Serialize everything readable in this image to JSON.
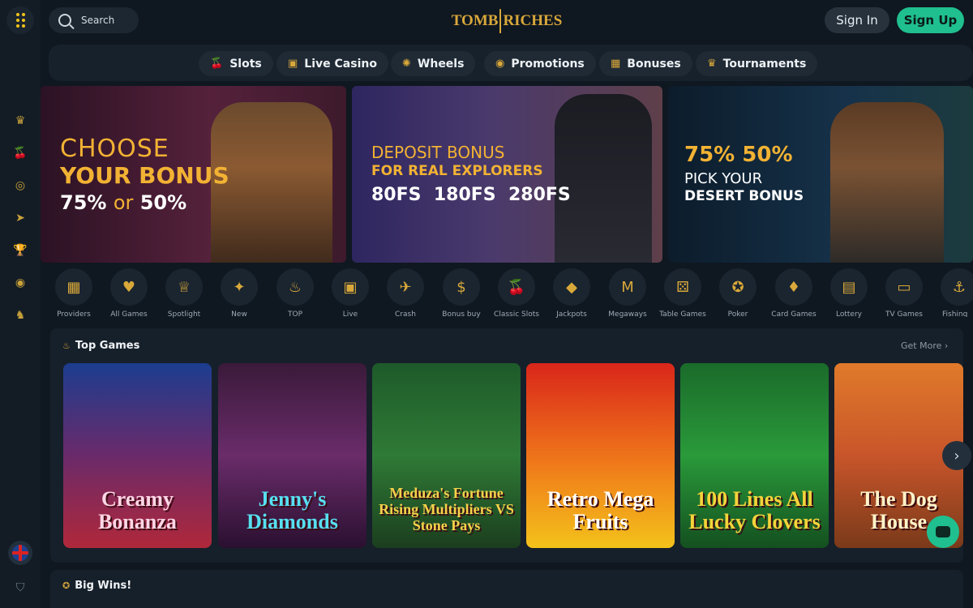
{
  "header": {
    "search_placeholder": "Search",
    "logo_text_left": "TOMB",
    "logo_text_right": "RICHES",
    "sign_in": "Sign In",
    "sign_up": "Sign Up"
  },
  "nav": {
    "items": [
      {
        "label": "Slots",
        "icon": "cherry-icon"
      },
      {
        "label": "Live Casino",
        "icon": "tv-icon"
      },
      {
        "label": "Wheels",
        "icon": "wheel-icon"
      },
      {
        "label": "Promotions",
        "icon": "ticket-icon"
      },
      {
        "label": "Bonuses",
        "icon": "gift-icon"
      },
      {
        "label": "Tournaments",
        "icon": "trophy-icon"
      }
    ]
  },
  "banners": {
    "b1": {
      "line1": "CHOOSE",
      "line2": "YOUR BONUS",
      "line3a": "75%",
      "line3b": "or",
      "line3c": "50%"
    },
    "b2": {
      "line1": "DEPOSIT BONUS",
      "line2": "FOR REAL EXPLORERS",
      "fs1": "80FS",
      "fs2": "180FS",
      "fs3": "280FS"
    },
    "b3": {
      "line1": "75% 50%",
      "line2": "PICK YOUR",
      "line3": "DESERT BONUS"
    }
  },
  "categories": [
    "Providers",
    "All Games",
    "Spotlight",
    "New",
    "TOP",
    "Live",
    "Crash",
    "Bonus buy",
    "Classic Slots",
    "Jackpots",
    "Megaways",
    "Table Games",
    "Poker",
    "Card Games",
    "Lottery",
    "TV Games",
    "Fishing"
  ],
  "top_games": {
    "title": "Top Games",
    "get_more": "Get More",
    "games": [
      {
        "title": "Creamy Bonanza"
      },
      {
        "title": "Jenny's Diamonds"
      },
      {
        "title": "Meduza's Fortune Rising Multipliers VS Stone Pays"
      },
      {
        "title": "Retro Mega Fruits"
      },
      {
        "title": "100 Lines All Lucky Clovers"
      },
      {
        "title": "The Dog House"
      }
    ]
  },
  "big_wins": {
    "title": "Big Wins!"
  },
  "colors": {
    "accent": "#1fbf8f",
    "gold": "#f2b233",
    "bg": "#0f1720"
  }
}
